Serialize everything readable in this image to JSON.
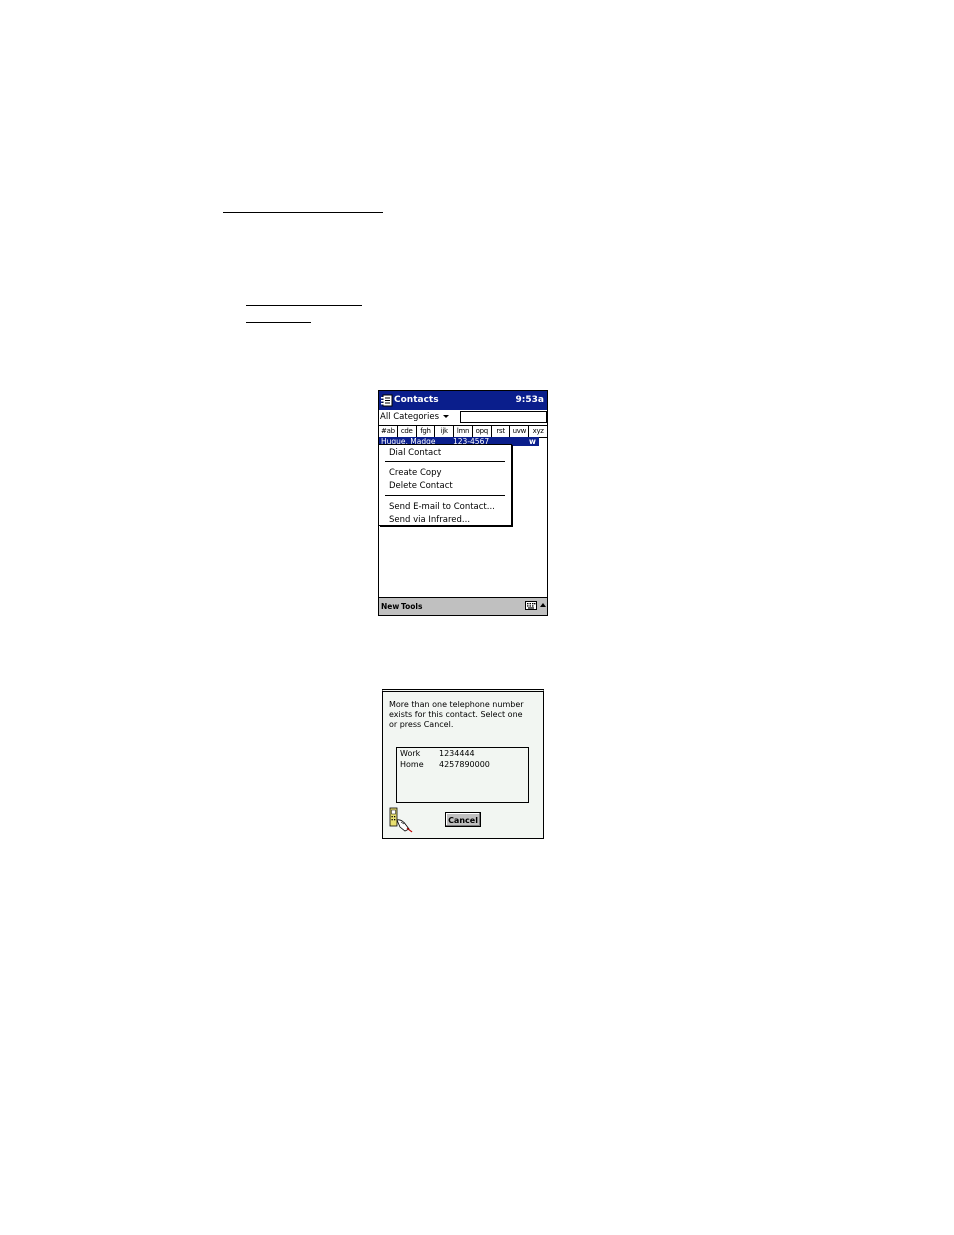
{
  "contacts_window": {
    "title": "Contacts",
    "clock": "9:53a",
    "category_filter": "All Categories",
    "find_value": "",
    "alpha_tabs": [
      "#ab",
      "cde",
      "fgh",
      "ijk",
      "lmn",
      "opq",
      "rst",
      "uvw",
      "xyz"
    ],
    "selected_contact": {
      "name": "Hugue, Madge",
      "phone": "123-4567",
      "type": "w"
    },
    "context_menu": {
      "items": [
        "Dial Contact",
        "Create Copy",
        "Delete Contact",
        "Send E-mail to Contact...",
        "Send via Infrared..."
      ]
    },
    "command_bar": {
      "new_label": "New",
      "tools_label": "Tools"
    },
    "colors": {
      "titlebar": "#0a1e8c",
      "command_bar": "#c0c0c0"
    }
  },
  "phone_dialog": {
    "message_lines": [
      "More than one telephone number",
      "exists for this contact.  Select one",
      "or press Cancel."
    ],
    "phone_numbers": [
      {
        "type": "Work",
        "number": "1234444"
      },
      {
        "type": "Home",
        "number": "4257890000"
      }
    ],
    "cancel_label": "Cancel",
    "background": "#f2f6f2"
  }
}
